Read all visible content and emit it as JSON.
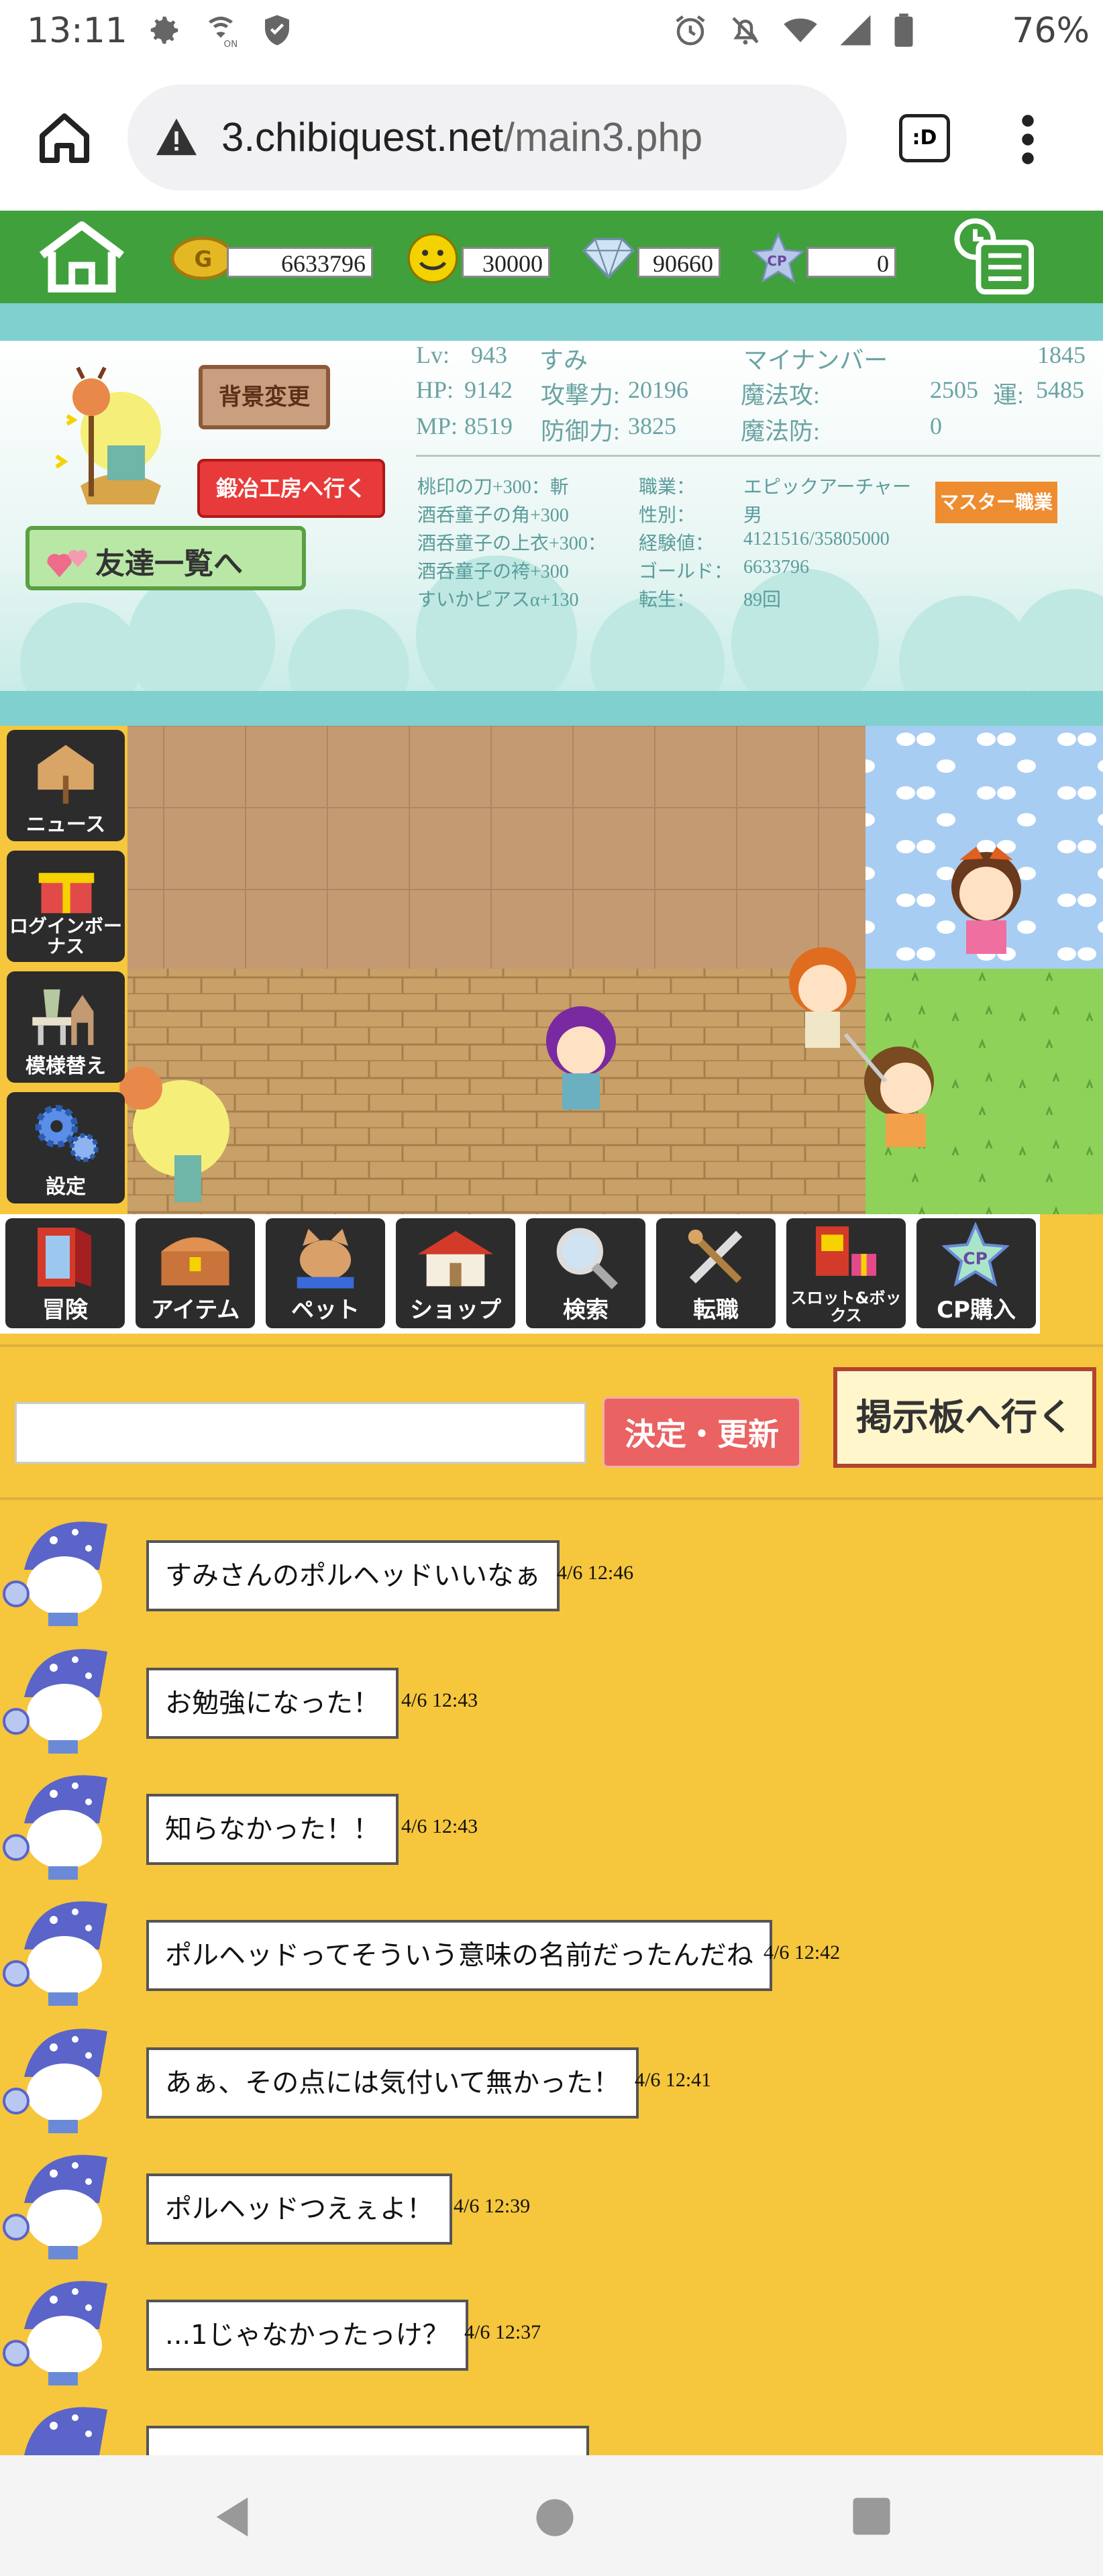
{
  "status_bar": {
    "time": "13:11",
    "battery": "76%"
  },
  "browser": {
    "url_host": "3.chibiquest.net",
    "url_path": "/main3.php",
    "tab_label": ":D"
  },
  "resources": {
    "gold": "6633796",
    "smile": "30000",
    "diamond": "90660",
    "cp": "0"
  },
  "profile": {
    "lv_label": "Lv:",
    "lv_value": "943",
    "name": "すみ",
    "my_number_label": "マイナンバー",
    "my_number": "1845",
    "hp_label": "HP:",
    "hp": "9142",
    "atk_label": "攻撃力:",
    "atk": "20196",
    "matk_label": "魔法攻:",
    "matk": "2505",
    "luck_label": "運:",
    "luck": "5485",
    "mp_label": "MP:",
    "mp": "8519",
    "def_label": "防御力:",
    "def": "3825",
    "mdef_label": "魔法防:",
    "mdef": "0",
    "bg_change": "背景変更",
    "smith_button": "鍛冶工房へ行く",
    "friends_button": "友達一覧へ",
    "master_job_button": "マスター職業",
    "equipment": [
      "桃印の刀+300：斬",
      "酒呑童子の角+300",
      "酒呑童子の上衣+300：",
      "酒呑童子の袴+300",
      "すいかピアスα+130"
    ],
    "info_labels": [
      "職業：",
      "性別：",
      "経験値：",
      "ゴールド：",
      "転生："
    ],
    "info_values": [
      "エピックアーチャー",
      "男",
      "4121516/35805000",
      "6633796",
      "89回"
    ]
  },
  "side_buttons": [
    "ニュース",
    "ログインボーナス",
    "模様替え",
    "設定"
  ],
  "menu_buttons": [
    "冒険",
    "アイテム",
    "ペット",
    "ショップ",
    "検索",
    "転職",
    "スロット&ボックス",
    "CP購入"
  ],
  "chat_controls": {
    "submit": "決定・更新",
    "bbs": "掲示板へ行く",
    "input_value": ""
  },
  "messages": [
    {
      "text": "すみさんのポルヘッドいいなぁ",
      "time": "4/6 12:46"
    },
    {
      "text": "お勉強になった！",
      "time": "4/6 12:43"
    },
    {
      "text": "知らなかった！！",
      "time": "4/6 12:43"
    },
    {
      "text": "ポルヘッドってそういう意味の名前だったんだね",
      "time": "4/6 12:42"
    },
    {
      "text": "あぁ、その点には気付いて無かった！",
      "time": "4/6 12:41"
    },
    {
      "text": "ポルヘッドつえぇよ！",
      "time": "4/6 12:39"
    },
    {
      "text": "...1じゃなかったっけ？",
      "time": "4/6 12:37"
    }
  ],
  "colors": {
    "header_green": "#3fa03c",
    "teal": "#7fd0ce",
    "chat_bg": "#f6c63c",
    "submit_red": "#ea6262"
  }
}
